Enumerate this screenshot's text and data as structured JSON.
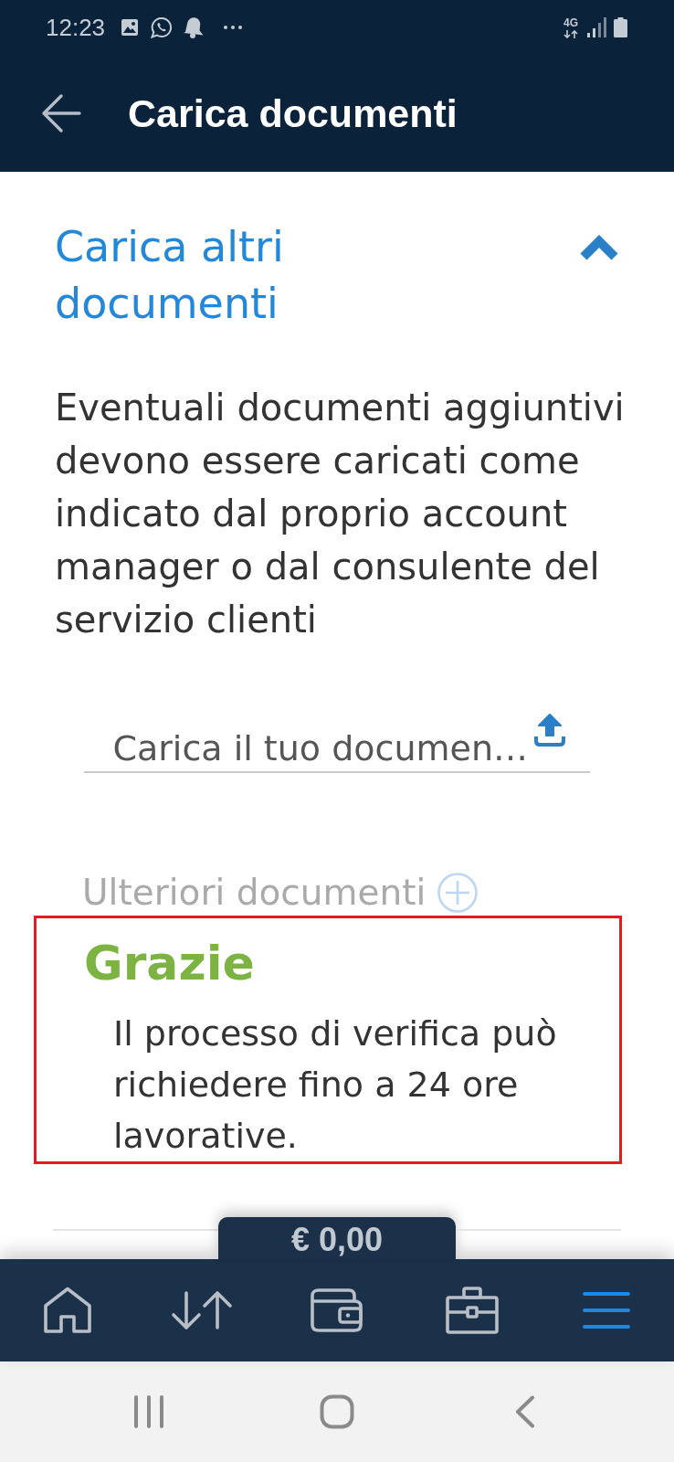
{
  "status_bar": {
    "time": "12:23",
    "network": "4G"
  },
  "app_bar": {
    "title": "Carica documenti"
  },
  "section": {
    "title": "Carica altri documenti",
    "expanded": true,
    "description": "Eventuali documenti aggiuntivi devono essere caricati come indicato dal proprio account manager o dal consulente del servizio clienti",
    "upload_field": {
      "placeholder": "Carica il tuo documen…"
    },
    "add_more": {
      "label": "Ulteriori documenti"
    }
  },
  "confirmation": {
    "title": "Grazie",
    "message": "Il processo di verifica può richiedere fino a 24 ore lavorative.",
    "highlighted": true
  },
  "balance_tab": {
    "amount": "€ 0,00"
  },
  "bottom_nav": [
    {
      "kind": "home",
      "selected": false
    },
    {
      "kind": "transfers",
      "selected": false
    },
    {
      "kind": "wallet",
      "selected": false
    },
    {
      "kind": "portfolio",
      "selected": false
    },
    {
      "kind": "menu",
      "selected": true
    }
  ]
}
